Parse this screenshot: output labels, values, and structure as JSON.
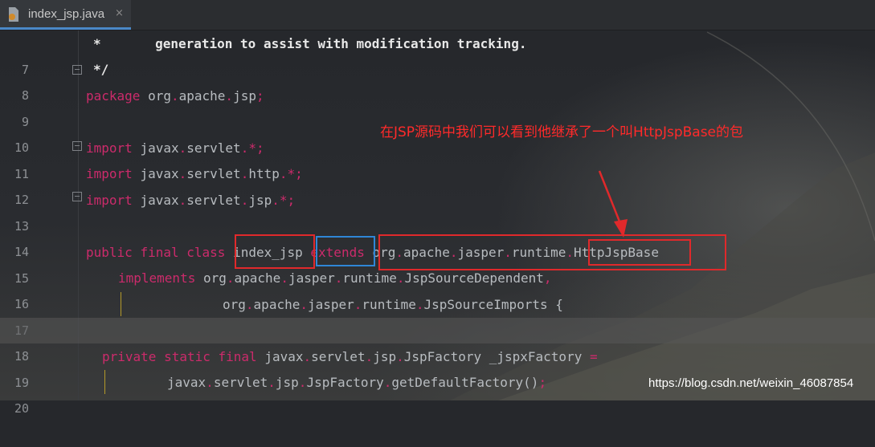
{
  "tab": {
    "label": "index_jsp.java",
    "close": "×",
    "icon": "java-class-file-icon"
  },
  "lines": [
    {
      "num": "7"
    },
    {
      "num": "8"
    },
    {
      "num": "9"
    },
    {
      "num": "10"
    },
    {
      "num": "11"
    },
    {
      "num": "12"
    },
    {
      "num": "13"
    },
    {
      "num": "14"
    },
    {
      "num": "15"
    },
    {
      "num": "16"
    },
    {
      "num": "17"
    },
    {
      "num": "18"
    },
    {
      "num": "19"
    },
    {
      "num": "20"
    }
  ],
  "code": {
    "l7": {
      "star": "*",
      "text": "generation to assist with modification tracking."
    },
    "l8": {
      "end": "*/"
    },
    "l9": {
      "kw": "package",
      "a": "org",
      "b": "apache",
      "c": "jsp",
      "semi": ";"
    },
    "l11": {
      "kw": "import",
      "a": "javax",
      "b": "servlet",
      "star": "*",
      "semi": ";"
    },
    "l12": {
      "kw": "import",
      "a": "javax",
      "b": "servlet",
      "c": "http",
      "star": "*",
      "semi": ";"
    },
    "l13": {
      "kw": "import",
      "a": "javax",
      "b": "servlet",
      "c": "jsp",
      "star": "*",
      "semi": ";"
    },
    "l15": {
      "k1": "public",
      "k2": "final",
      "k3": "class",
      "name": "index_jsp",
      "ext": "extends",
      "a": "org",
      "b": "apache",
      "c": "jasper",
      "d": "runtime",
      "base": "HttpJspBase"
    },
    "l16": {
      "kw": "implements",
      "a": "org",
      "b": "apache",
      "c": "jasper",
      "d": "runtime",
      "e": "JspSourceDependent",
      "comma": ","
    },
    "l17": {
      "a": "org",
      "b": "apache",
      "c": "jasper",
      "d": "runtime",
      "e": "JspSourceImports",
      "brace": "{"
    },
    "l19": {
      "k1": "private",
      "k2": "static",
      "k3": "final",
      "a": "javax",
      "b": "servlet",
      "c": "jsp",
      "d": "JspFactory",
      "var": "_jspxFactory",
      "eq": "="
    },
    "l20": {
      "a": "javax",
      "b": "servlet",
      "c": "jsp",
      "d": "JspFactory",
      "m": "getDefaultFactory",
      "paren": "()",
      "semi": ";"
    }
  },
  "annotation": "在JSP源码中我们可以看到他继承了一个叫HttpJspBase的包",
  "watermark": "https://blog.csdn.net/weixin_46087854",
  "colors": {
    "keyword": "#cc2b6b",
    "identifier": "#b8bcc0",
    "annotation": "#ff2a2a",
    "highlight_box": "#e0292b",
    "extends_box": "#2f86d6"
  }
}
